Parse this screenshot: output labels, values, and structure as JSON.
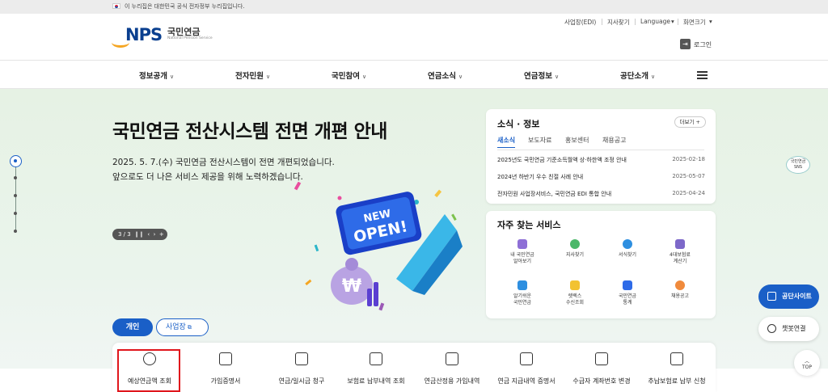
{
  "gov_banner": {
    "text": "이 누리집은 대한민국 공식 전자정부 누리집입니다."
  },
  "header": {
    "logo_text": "NPS",
    "logo_korean": "국민연금",
    "logo_english": "National Pension Service",
    "util_links": [
      "사업장(EDI)",
      "지사찾기",
      "Language",
      "화면크기"
    ],
    "login_label": "로그인"
  },
  "gnb": {
    "items": [
      "정보공개",
      "전자민원",
      "국민참여",
      "연금소식",
      "연금정보",
      "공단소개"
    ]
  },
  "hero": {
    "title": "국민연금 전산시스템 전면 개편 안내",
    "desc_line1": "2025. 5. 7.(수) 국민연금 전산시스템이 전면 개편되었습니다.",
    "desc_line2": "앞으로도 더 나은 서비스 제공을 위해 노력하겠습니다.",
    "slide_counter": "3 / 3",
    "badge_line1": "NEW",
    "badge_line2": "OPEN!"
  },
  "news": {
    "title": "소식 · 정보",
    "more_label": "더보기 +",
    "tabs": [
      "새소식",
      "보도자료",
      "홍보센터",
      "채용공고"
    ],
    "rows": [
      {
        "title": "2025년도 국민연금 기준소득월액 상·하한액 조정 안내",
        "date": "2025-02-18"
      },
      {
        "title": "2024년 하반기 우수 친절 사례 안내",
        "date": "2025-05-07"
      },
      {
        "title": "전자민원 사업장서비스, 국민연금 EDI 통합 안내",
        "date": "2025-04-24"
      }
    ]
  },
  "services": {
    "title": "자주 찾는 서비스",
    "items": [
      {
        "line1": "내 국민연금",
        "line2": "알아보기"
      },
      {
        "line1": "지사찾기",
        "line2": ""
      },
      {
        "line1": "서식찾기",
        "line2": ""
      },
      {
        "line1": "4대보험료",
        "line2": "계산기"
      },
      {
        "line1": "알기쉬운",
        "line2": "국민연금"
      },
      {
        "line1": "렛렉스",
        "line2": "수신조회"
      },
      {
        "line1": "국민연금",
        "line2": "통계"
      },
      {
        "line1": "채용공고",
        "line2": ""
      }
    ]
  },
  "side": {
    "sns_line1": "국민연금",
    "sns_line2": "SNS",
    "site_label": "공단사이트",
    "chat_label": "챗봇연결",
    "top_label": "TOP"
  },
  "tabs": {
    "individual": "개인",
    "business": "사업장"
  },
  "quick_menu": [
    "예상연금액 조회",
    "가입증명서",
    "연금/일시금 청구",
    "보험료 납부내역 조회",
    "연금산정용 가입내역",
    "연금 지급내역 증명서",
    "수급자 계좌번호 변경",
    "추납보험료 납부 신청"
  ],
  "colors": {
    "brand_blue": "#1a5fc7",
    "brand_navy": "#0a3f8f",
    "accent_orange": "#f5a623",
    "highlight_red": "#e0161c"
  }
}
